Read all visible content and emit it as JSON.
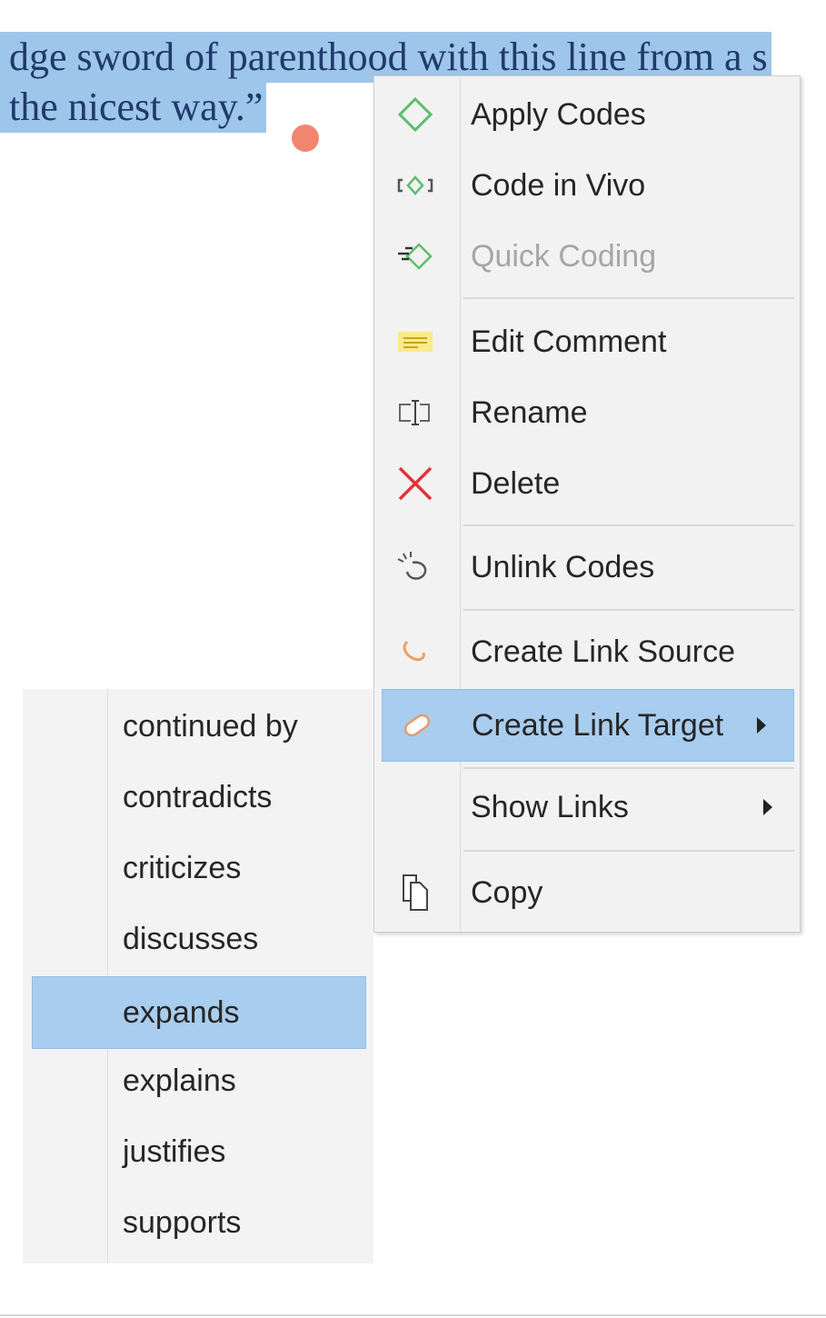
{
  "document": {
    "line1": "dge sword of parenthood with this line from a s",
    "line2": "the nicest way.”"
  },
  "context_menu": {
    "items": [
      {
        "label": "Apply Codes",
        "icon": "apply-codes-icon"
      },
      {
        "label": "Code in Vivo",
        "icon": "code-in-vivo-icon"
      },
      {
        "label": "Quick Coding",
        "icon": "quick-coding-icon",
        "disabled": true
      },
      {
        "label": "Edit Comment",
        "icon": "comment-icon"
      },
      {
        "label": "Rename",
        "icon": "rename-icon"
      },
      {
        "label": "Delete",
        "icon": "delete-icon"
      },
      {
        "label": "Unlink Codes",
        "icon": "unlink-icon"
      },
      {
        "label": "Create Link Source",
        "icon": "link-source-icon"
      },
      {
        "label": "Create Link Target",
        "icon": "link-target-icon",
        "highlighted": true,
        "submenu": true
      },
      {
        "label": "Show Links",
        "submenu": true
      },
      {
        "label": "Copy",
        "icon": "copy-icon"
      }
    ]
  },
  "link_target_submenu": {
    "items": [
      "continued by",
      "contradicts",
      "criticizes",
      "discusses",
      "expands",
      "explains",
      "justifies",
      "supports"
    ],
    "highlighted": "expands"
  },
  "colors": {
    "selection": "#9ec5ea",
    "menu_highlight": "#a9cdee",
    "selection_handle": "#f2856f",
    "delete_red": "#e0333a",
    "code_green": "#5cbf6a"
  }
}
